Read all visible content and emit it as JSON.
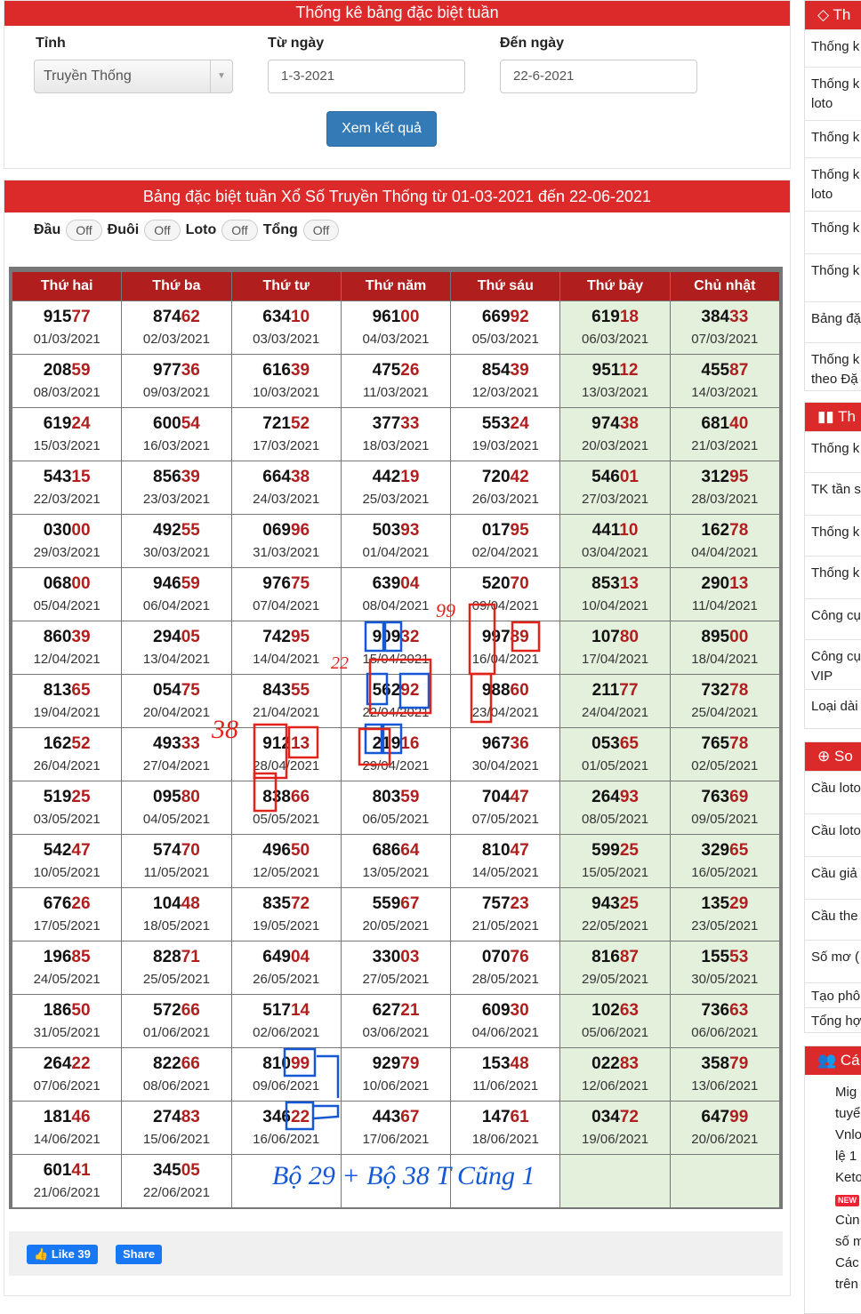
{
  "filter": {
    "title": "Thống kê bảng đặc biệt tuần",
    "province_label": "Tỉnh",
    "province_value": "Truyền Thống",
    "from_label": "Từ ngày",
    "from_value": "1-3-2021",
    "to_label": "Đến ngày",
    "to_value": "22-6-2021",
    "submit": "Xem kết quả"
  },
  "results": {
    "title": "Bảng đặc biệt tuần Xổ Số Truyền Thống từ 01-03-2021 đến 22-06-2021",
    "toggles": [
      {
        "label": "Đầu",
        "state": "Off"
      },
      {
        "label": "Đuôi",
        "state": "Off"
      },
      {
        "label": "Loto",
        "state": "Off"
      },
      {
        "label": "Tổng",
        "state": "Off"
      }
    ],
    "days": [
      "Thứ hai",
      "Thứ ba",
      "Thứ tư",
      "Thứ năm",
      "Thứ sáu",
      "Thứ bảy",
      "Chủ nhật"
    ],
    "rows": [
      [
        [
          "91577",
          "01/03/2021"
        ],
        [
          "87462",
          "02/03/2021"
        ],
        [
          "63410",
          "03/03/2021"
        ],
        [
          "96100",
          "04/03/2021"
        ],
        [
          "66992",
          "05/03/2021"
        ],
        [
          "61918",
          "06/03/2021"
        ],
        [
          "38433",
          "07/03/2021"
        ]
      ],
      [
        [
          "20859",
          "08/03/2021"
        ],
        [
          "97736",
          "09/03/2021"
        ],
        [
          "61639",
          "10/03/2021"
        ],
        [
          "47526",
          "11/03/2021"
        ],
        [
          "85439",
          "12/03/2021"
        ],
        [
          "95112",
          "13/03/2021"
        ],
        [
          "45587",
          "14/03/2021"
        ]
      ],
      [
        [
          "61924",
          "15/03/2021"
        ],
        [
          "60054",
          "16/03/2021"
        ],
        [
          "72152",
          "17/03/2021"
        ],
        [
          "37733",
          "18/03/2021"
        ],
        [
          "55324",
          "19/03/2021"
        ],
        [
          "97438",
          "20/03/2021"
        ],
        [
          "68140",
          "21/03/2021"
        ]
      ],
      [
        [
          "54315",
          "22/03/2021"
        ],
        [
          "85639",
          "23/03/2021"
        ],
        [
          "66438",
          "24/03/2021"
        ],
        [
          "44219",
          "25/03/2021"
        ],
        [
          "72042",
          "26/03/2021"
        ],
        [
          "54601",
          "27/03/2021"
        ],
        [
          "31295",
          "28/03/2021"
        ]
      ],
      [
        [
          "03000",
          "29/03/2021"
        ],
        [
          "49255",
          "30/03/2021"
        ],
        [
          "06996",
          "31/03/2021"
        ],
        [
          "50393",
          "01/04/2021"
        ],
        [
          "01795",
          "02/04/2021"
        ],
        [
          "44110",
          "03/04/2021"
        ],
        [
          "16278",
          "04/04/2021"
        ]
      ],
      [
        [
          "06800",
          "05/04/2021"
        ],
        [
          "94659",
          "06/04/2021"
        ],
        [
          "97675",
          "07/04/2021"
        ],
        [
          "63904",
          "08/04/2021"
        ],
        [
          "52070",
          "09/04/2021"
        ],
        [
          "85313",
          "10/04/2021"
        ],
        [
          "29013",
          "11/04/2021"
        ]
      ],
      [
        [
          "86039",
          "12/04/2021"
        ],
        [
          "29405",
          "13/04/2021"
        ],
        [
          "74295",
          "14/04/2021"
        ],
        [
          "90932",
          "15/04/2021"
        ],
        [
          "99789",
          "16/04/2021"
        ],
        [
          "10780",
          "17/04/2021"
        ],
        [
          "89500",
          "18/04/2021"
        ]
      ],
      [
        [
          "81365",
          "19/04/2021"
        ],
        [
          "05475",
          "20/04/2021"
        ],
        [
          "84355",
          "21/04/2021"
        ],
        [
          "56292",
          "22/04/2021"
        ],
        [
          "98860",
          "23/04/2021"
        ],
        [
          "21177",
          "24/04/2021"
        ],
        [
          "73278",
          "25/04/2021"
        ]
      ],
      [
        [
          "16252",
          "26/04/2021"
        ],
        [
          "49333",
          "27/04/2021"
        ],
        [
          "91213",
          "28/04/2021"
        ],
        [
          "21916",
          "29/04/2021"
        ],
        [
          "96736",
          "30/04/2021"
        ],
        [
          "05365",
          "01/05/2021"
        ],
        [
          "76578",
          "02/05/2021"
        ]
      ],
      [
        [
          "51925",
          "03/05/2021"
        ],
        [
          "09580",
          "04/05/2021"
        ],
        [
          "83866",
          "05/05/2021"
        ],
        [
          "80359",
          "06/05/2021"
        ],
        [
          "70447",
          "07/05/2021"
        ],
        [
          "26493",
          "08/05/2021"
        ],
        [
          "76369",
          "09/05/2021"
        ]
      ],
      [
        [
          "54247",
          "10/05/2021"
        ],
        [
          "57470",
          "11/05/2021"
        ],
        [
          "49650",
          "12/05/2021"
        ],
        [
          "68664",
          "13/05/2021"
        ],
        [
          "81047",
          "14/05/2021"
        ],
        [
          "59925",
          "15/05/2021"
        ],
        [
          "32965",
          "16/05/2021"
        ]
      ],
      [
        [
          "67626",
          "17/05/2021"
        ],
        [
          "10448",
          "18/05/2021"
        ],
        [
          "83572",
          "19/05/2021"
        ],
        [
          "55967",
          "20/05/2021"
        ],
        [
          "75723",
          "21/05/2021"
        ],
        [
          "94325",
          "22/05/2021"
        ],
        [
          "13529",
          "23/05/2021"
        ]
      ],
      [
        [
          "19685",
          "24/05/2021"
        ],
        [
          "82871",
          "25/05/2021"
        ],
        [
          "64904",
          "26/05/2021"
        ],
        [
          "33003",
          "27/05/2021"
        ],
        [
          "07076",
          "28/05/2021"
        ],
        [
          "81687",
          "29/05/2021"
        ],
        [
          "15553",
          "30/05/2021"
        ]
      ],
      [
        [
          "18650",
          "31/05/2021"
        ],
        [
          "57266",
          "01/06/2021"
        ],
        [
          "51714",
          "02/06/2021"
        ],
        [
          "62721",
          "03/06/2021"
        ],
        [
          "60930",
          "04/06/2021"
        ],
        [
          "10263",
          "05/06/2021"
        ],
        [
          "73663",
          "06/06/2021"
        ]
      ],
      [
        [
          "26422",
          "07/06/2021"
        ],
        [
          "82266",
          "08/06/2021"
        ],
        [
          "81099",
          "09/06/2021"
        ],
        [
          "92979",
          "10/06/2021"
        ],
        [
          "15348",
          "11/06/2021"
        ],
        [
          "02283",
          "12/06/2021"
        ],
        [
          "35879",
          "13/06/2021"
        ]
      ],
      [
        [
          "18146",
          "14/06/2021"
        ],
        [
          "27483",
          "15/06/2021"
        ],
        [
          "34622",
          "16/06/2021"
        ],
        [
          "44367",
          "17/06/2021"
        ],
        [
          "14761",
          "18/06/2021"
        ],
        [
          "03472",
          "19/06/2021"
        ],
        [
          "64799",
          "20/06/2021"
        ]
      ],
      [
        [
          "60141",
          "21/06/2021"
        ],
        [
          "34505",
          "22/06/2021"
        ],
        [
          "",
          ""
        ],
        [
          "",
          ""
        ],
        [
          "",
          ""
        ],
        [
          "",
          ""
        ],
        [
          "",
          ""
        ]
      ]
    ],
    "handwriting": [
      "99",
      "22",
      "38",
      "Bộ 29 + Bộ 38 T Cũng 1"
    ]
  },
  "social": {
    "like": "Like 39",
    "share": "Share"
  },
  "sidebar": {
    "sections": [
      {
        "header": "Th",
        "icon": "diamond-icon",
        "items": [
          "Thống k",
          "Thống k loto",
          "Thống k",
          "Thống k loto",
          "Thống k",
          "Thống k",
          "Bảng đặ",
          "Thống k theo Đặ"
        ]
      },
      {
        "header": "Th",
        "icon": "bar-chart-icon",
        "items": [
          "Thống k",
          "TK tần s",
          "Thống k",
          "Thống k",
          "Công cụ",
          "Công cụ VIP",
          "Loại dài"
        ]
      },
      {
        "header": "So",
        "icon": "search-plus-icon",
        "items": [
          "Cầu loto",
          "Cầu loto",
          "Cầu giả",
          "Cầu the",
          "Số mơ (",
          "Tạo phô",
          "Tổng hợ"
        ]
      },
      {
        "header": "Cá",
        "icon": "users-icon",
        "list": [
          "Mig tuyể",
          "Vnlo lệ 1",
          "Keto",
          "Cùn số m",
          "Các trên"
        ],
        "new_badge": "NEW"
      }
    ]
  },
  "colors": {
    "header_red": "#dc2a2a",
    "table_head": "#b01e1e",
    "weekend_bg": "#e3f0dc",
    "pen_blue": "#1558d6",
    "pen_red": "#e0241c"
  }
}
